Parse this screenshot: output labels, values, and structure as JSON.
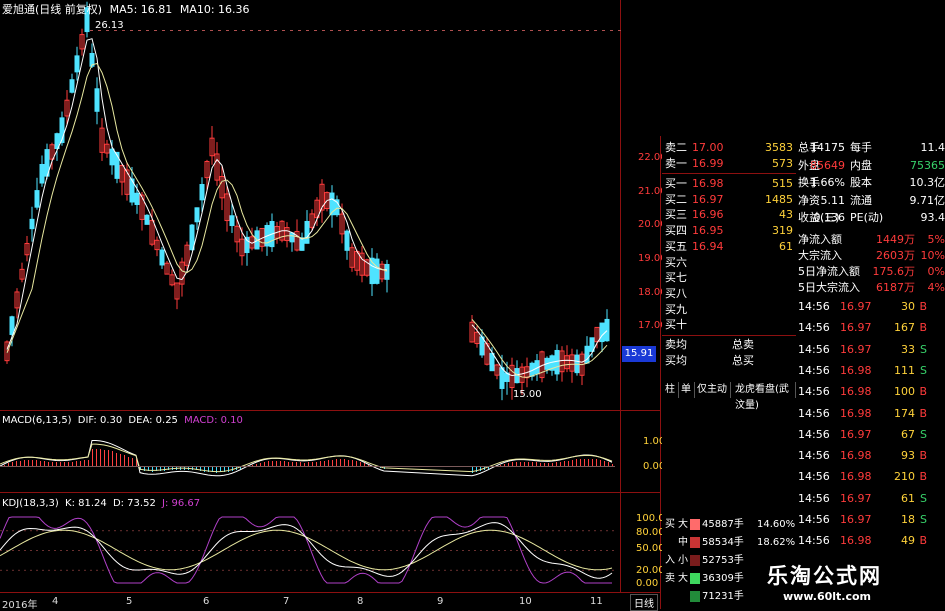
{
  "chart_header": {
    "title": "爱旭通(日线 前复权)",
    "ma5": "MA5: 16.81",
    "ma10": "MA10: 16.36",
    "high_label": "26.13",
    "low_label": "15.00",
    "current_price_tag": "15.91"
  },
  "price_axis": [
    "22.00",
    "21.00",
    "20.00",
    "19.00",
    "18.00",
    "17.00",
    "16.00"
  ],
  "macd": {
    "label": "MACD(6,13,5)",
    "dif": "DIF: 0.30",
    "dea": "DEA: 0.25",
    "macd": "MACD: 0.10",
    "axis": [
      "1.00",
      "0.00"
    ]
  },
  "kdj": {
    "label": "KDJ(18,3,3)",
    "k": "K: 81.24",
    "d": "D: 73.52",
    "j": "J: 96.67",
    "axis": [
      "100.00",
      "80.00",
      "50.00",
      "20.00",
      "0.00"
    ]
  },
  "date_axis": [
    "2016年",
    "4",
    "5",
    "6",
    "7",
    "8",
    "9",
    "10",
    "11"
  ],
  "period_button": "日线",
  "order_book": {
    "sells": [
      {
        "label": "卖二",
        "price": "17.00",
        "volume": "3583"
      },
      {
        "label": "卖一",
        "price": "16.99",
        "volume": "573"
      }
    ],
    "buys": [
      {
        "label": "买一",
        "price": "16.98",
        "volume": "515"
      },
      {
        "label": "买二",
        "price": "16.97",
        "volume": "1485"
      },
      {
        "label": "买三",
        "price": "16.96",
        "volume": "43"
      },
      {
        "label": "买四",
        "price": "16.95",
        "volume": "319"
      },
      {
        "label": "买五",
        "price": "16.94",
        "volume": "61"
      },
      {
        "label": "买六",
        "price": "",
        "volume": ""
      },
      {
        "label": "买七",
        "price": "",
        "volume": ""
      },
      {
        "label": "买八",
        "price": "",
        "volume": ""
      },
      {
        "label": "买九",
        "price": "",
        "volume": ""
      },
      {
        "label": "买十",
        "price": "",
        "volume": ""
      }
    ],
    "avg_sell_label": "卖均",
    "avg_buy_label": "买均",
    "total_sell_label": "总卖",
    "total_buy_label": "总买"
  },
  "stats": [
    {
      "k1": "总手",
      "v1": "14175",
      "k2": "每手",
      "v2": "11.4"
    },
    {
      "k1": "外盘",
      "v1": "85649",
      "k2": "内盘",
      "v2": "75365"
    },
    {
      "k1": "换手",
      "v1": "1.66%",
      "k2": "股本",
      "v2": "10.3亿"
    },
    {
      "k1": "净资",
      "v1": "5.11",
      "k2": "流通",
      "v2": "9.71亿"
    },
    {
      "k1": "收益(三)",
      "v1": "0.136",
      "k2": "PE(动)",
      "v2": "93.4"
    }
  ],
  "flows": [
    {
      "label": "净流入额",
      "value": "1449万",
      "pct": "5%"
    },
    {
      "label": "大宗流入",
      "value": "2603万",
      "pct": "10%"
    },
    {
      "label": "5日净流入额",
      "value": "175.6万",
      "pct": "0%"
    },
    {
      "label": "5日大宗流入",
      "value": "6187万",
      "pct": "4%"
    }
  ],
  "ticks": [
    {
      "time": "14:56",
      "price": "16.97",
      "vol": "30",
      "side": "B"
    },
    {
      "time": "14:56",
      "price": "16.97",
      "vol": "167",
      "side": "B"
    },
    {
      "time": "14:56",
      "price": "16.97",
      "vol": "33",
      "side": "S"
    },
    {
      "time": "14:56",
      "price": "16.98",
      "vol": "111",
      "side": "S"
    },
    {
      "time": "14:56",
      "price": "16.98",
      "vol": "100",
      "side": "B"
    },
    {
      "time": "14:56",
      "price": "16.98",
      "vol": "174",
      "side": "B"
    },
    {
      "time": "14:56",
      "price": "16.97",
      "vol": "67",
      "side": "S"
    },
    {
      "time": "14:56",
      "price": "16.98",
      "vol": "93",
      "side": "B"
    },
    {
      "time": "14:56",
      "price": "16.98",
      "vol": "210",
      "side": "B"
    },
    {
      "time": "14:56",
      "price": "16.97",
      "vol": "61",
      "side": "S"
    },
    {
      "time": "14:56",
      "price": "16.97",
      "vol": "18",
      "side": "S"
    },
    {
      "time": "14:56",
      "price": "16.98",
      "vol": "49",
      "side": "B"
    },
    {
      "time": "14:56",
      "price": "16.97",
      "vol": "144",
      "side": "S"
    },
    {
      "time": "14:56",
      "price": "16.97",
      "vol": "13",
      "side": "S"
    }
  ],
  "tabs": [
    "柱",
    "单",
    "仅主动",
    "龙虎看盘(武汶量)"
  ],
  "fund_flow": [
    {
      "side": "买",
      "size": "大",
      "value": "45887手",
      "pct": "14.60%",
      "color": "#ff6b6b"
    },
    {
      "side": "",
      "size": "中",
      "value": "58534手",
      "pct": "18.62%",
      "color": "#c83434"
    },
    {
      "side": "入",
      "size": "小",
      "value": "52753手",
      "pct": "",
      "color": "#7a1c1c"
    },
    {
      "side": "卖",
      "size": "大",
      "value": "36309手",
      "pct": "",
      "color": "#3ed75e"
    },
    {
      "side": "",
      "size": "",
      "value": "71231手",
      "pct": "",
      "color": "#228b3a"
    }
  ],
  "pie_colors": {
    "buy_big": "#ff6161",
    "buy_mid": "#c43030",
    "buy_small": "#6a1616",
    "sell_big": "#44dd66",
    "sell_mid": "#1f8a3a",
    "sell_small": "#0f5a24"
  },
  "watermark": {
    "text": "乐淘公式网",
    "url": "www.60lt.com"
  }
}
